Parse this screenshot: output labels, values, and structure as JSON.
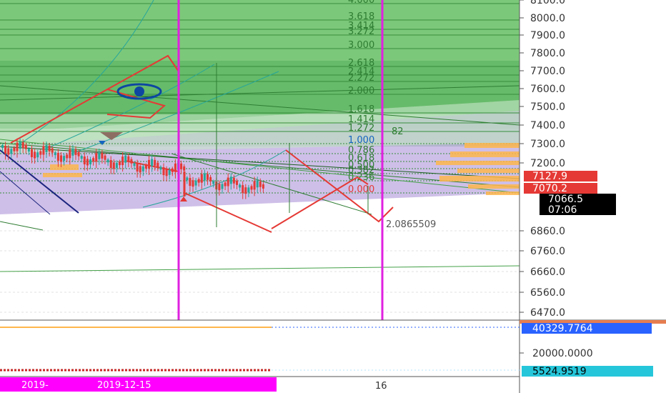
{
  "chart_data": {
    "type": "line",
    "price_axis": {
      "tick_labels": [
        "8100.0",
        "8000.0",
        "7900.0",
        "7800.0",
        "7700.0",
        "7600.0",
        "7500.0",
        "7400.0",
        "7300.0",
        "7200.0",
        "6860.0",
        "6760.0",
        "6660.0",
        "6560.0",
        "6470.0"
      ],
      "price_tags": [
        {
          "label": "7127.9",
          "bg": "#e53935",
          "fg": "#ffffff"
        },
        {
          "label": "7070.2",
          "bg": "#e53935",
          "fg": "#ffffff"
        },
        {
          "label": "7066.5",
          "bg": "#000000",
          "fg": "#ffffff"
        },
        {
          "label": "07:06",
          "bg": "#000000",
          "fg": "#ffffff"
        }
      ]
    },
    "fib_extension_levels": [
      "4.000",
      "3.618",
      "3.414",
      "3.272",
      "3.000",
      "2.618",
      "2.414",
      "2.272",
      "2.000",
      "1.618",
      "1.414",
      "1.272",
      "1.000",
      "0.786",
      "0.618",
      "0.500",
      "0.382",
      "0.236",
      "0.000"
    ],
    "fib_extra_labels": [
      "82"
    ],
    "measure_label": "2.0865509",
    "indicator_axis": {
      "tick_labels": [
        "20000.0000"
      ],
      "value_tags": [
        {
          "label": "40329.7764",
          "bg": "#2962ff",
          "fg": "#ffffff"
        },
        {
          "label": "5524.9519",
          "bg": "#26c6da",
          "fg": "#000000"
        }
      ]
    },
    "time_axis": {
      "highlighted_labels": [
        "2019-",
        "2019-12-15"
      ],
      "highlight_bg": "#ff00ff",
      "tick_labels": [
        "16"
      ]
    },
    "colors": {
      "fib_zone_green": "#4caf50",
      "vertical_marker": "#e020e0",
      "drawing_red": "#e53935",
      "volume_profile": "#ffb74d"
    },
    "grid": true
  }
}
